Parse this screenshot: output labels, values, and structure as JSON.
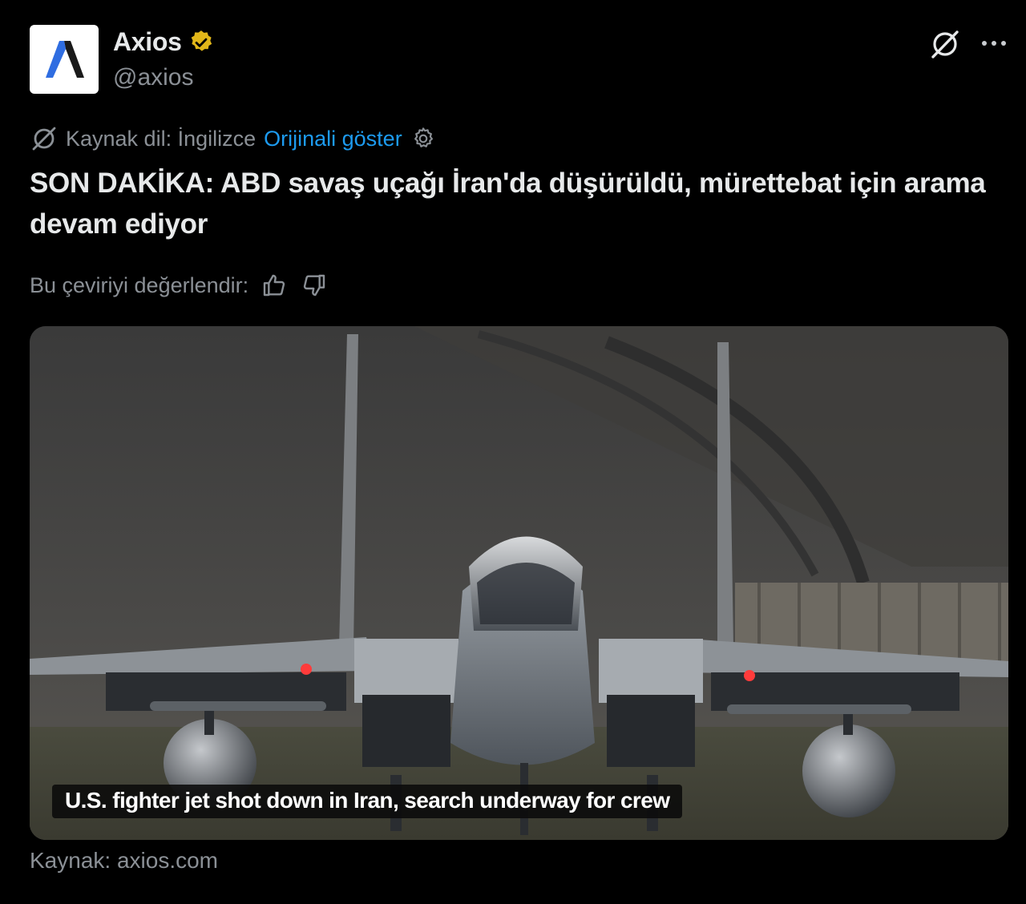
{
  "colors": {
    "background": "#000000",
    "text_primary": "#e7e9ea",
    "text_secondary": "#8b9096",
    "link": "#1d9bf0",
    "verified_badge": "#e2b719"
  },
  "author": {
    "name": "Axios",
    "handle": "@axios",
    "avatar_icon": "axios-logo-icon",
    "verified_icon": "verified-badge-icon"
  },
  "header_actions": {
    "grok_icon": "grok-icon",
    "more_icon": "more-options-icon"
  },
  "translation": {
    "icon": "translate-icon",
    "source_language": "Kaynak dil: İngilizce",
    "show_original": "Orijinali göster",
    "settings_icon": "gear-icon"
  },
  "tweet": {
    "text": "SON DAKİKA: ABD savaş uçağı İran'da düşürüldü, mürettebat için arama devam ediyor"
  },
  "rating": {
    "label": "Bu çeviriyi değerlendir:",
    "thumbs_up_icon": "thumbs-up-icon",
    "thumbs_down_icon": "thumbs-down-icon"
  },
  "media": {
    "caption": "U.S. fighter jet shot down in Iran, search underway for crew"
  },
  "card_source": {
    "text": "Kaynak: axios.com"
  }
}
